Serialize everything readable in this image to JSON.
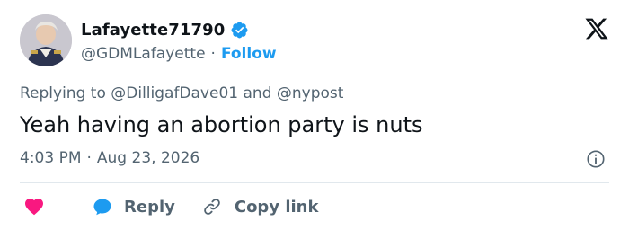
{
  "author": {
    "display_name": "Lafayette71790",
    "handle": "@GDMLafayette",
    "separator": "·",
    "follow_label": "Follow",
    "verified": true
  },
  "reply_context": {
    "prefix": "Replying to",
    "mention_1": "@DilligafDave01",
    "conjunction": "and",
    "mention_2": "@nypost"
  },
  "tweet": {
    "text": "Yeah having an abortion party is nuts",
    "time": "4:03 PM",
    "separator": "·",
    "date": "Aug 23, 2026"
  },
  "actions": {
    "reply_label": "Reply",
    "copy_link_label": "Copy link"
  },
  "colors": {
    "accent": "#1d9bf0",
    "like": "#f91880",
    "text": "#0f1419",
    "muted": "#536471"
  },
  "icons": [
    "verified-icon",
    "x-logo-icon",
    "info-icon",
    "heart-icon",
    "reply-bubble-icon",
    "link-icon"
  ]
}
